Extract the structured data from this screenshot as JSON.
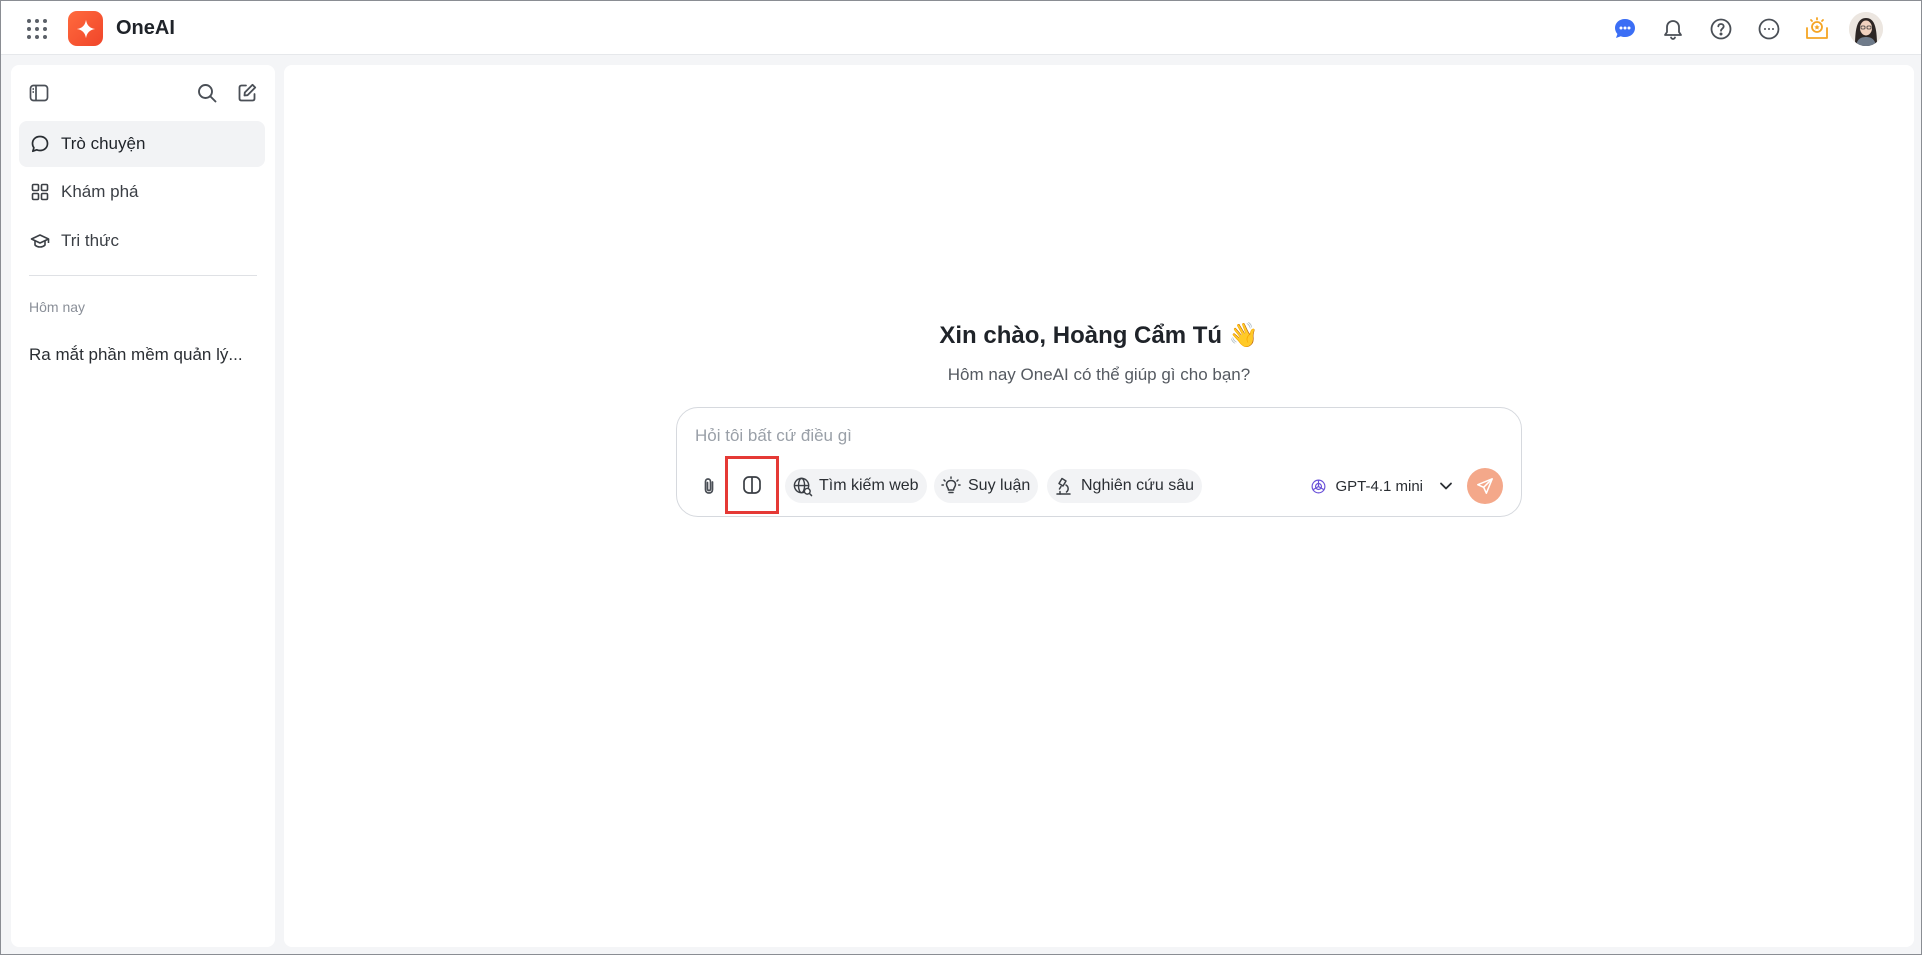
{
  "app": {
    "name": "OneAI"
  },
  "topbar": {
    "icons": [
      "apps-grid-icon",
      "chat-bubble-icon",
      "bell-icon",
      "help-icon",
      "more-icon",
      "reward-icon"
    ],
    "accent": "#3b6ef5",
    "reward_color": "#f5a524"
  },
  "sidebar": {
    "nav": [
      {
        "label": "Trò chuyện",
        "icon": "chat-icon",
        "active": true
      },
      {
        "label": "Khám phá",
        "icon": "grid-icon",
        "active": false
      },
      {
        "label": "Tri thức",
        "icon": "graduation-cap-icon",
        "active": false
      }
    ],
    "section_label": "Hôm nay",
    "history": [
      {
        "title": "Ra mắt phần mềm quản lý..."
      }
    ]
  },
  "main": {
    "greeting": "Xin chào, Hoàng Cẩm Tú 👋",
    "subtext": "Hôm nay OneAI có thể giúp gì cho bạn?",
    "composer": {
      "placeholder": "Hỏi tôi bất cứ điều gì",
      "value": "",
      "tools": [
        {
          "label": "Tìm kiếm web",
          "icon": "globe-search-icon"
        },
        {
          "label": "Suy luận",
          "icon": "lightbulb-icon"
        },
        {
          "label": "Nghiên cứu sâu",
          "icon": "microscope-icon"
        }
      ],
      "model": "GPT-4.1 mini",
      "send_color": "#f4a88a"
    }
  }
}
